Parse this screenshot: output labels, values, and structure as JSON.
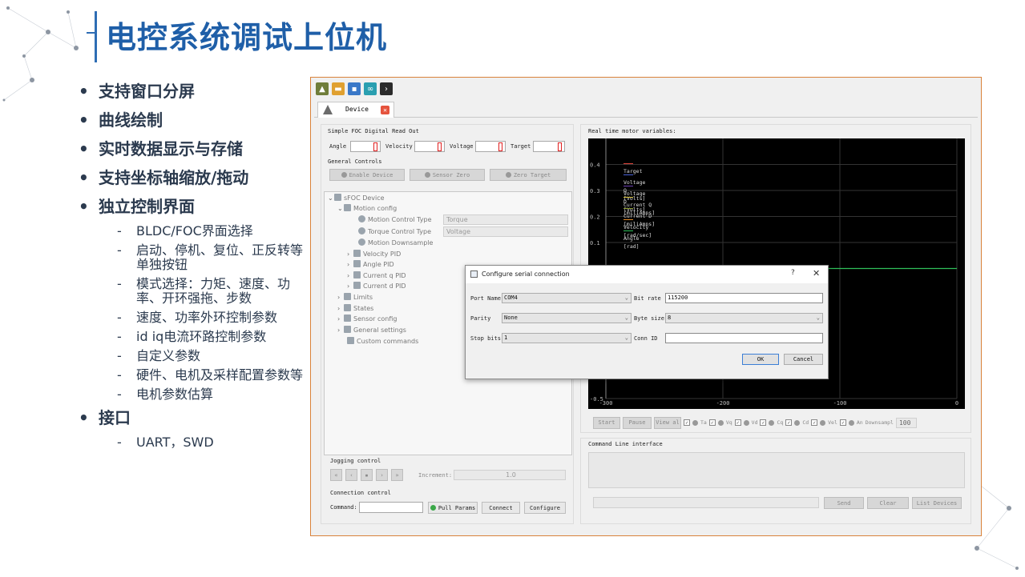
{
  "slide": {
    "title": "电控系统调试上位机",
    "bullets": [
      {
        "text": "支持窗口分屏"
      },
      {
        "text": "曲线绘制"
      },
      {
        "text": "实时数据显示与存储"
      },
      {
        "text": "支持坐标轴缩放/拖动"
      },
      {
        "text": "独立控制界面"
      }
    ],
    "sub_bullets": [
      "BLDC/FOC界面选择",
      "启动、停机、复位、正反转等单独按钮",
      "模式选择：力矩、速度、功率、开环强拖、步数",
      "速度、功率外环控制参数",
      "id iq电流环路控制参数",
      "自定义参数",
      "硬件、电机及采样配置参数等",
      "电机参数估算"
    ],
    "bullet_interface": "接口",
    "sub_interface": "UART，SWD",
    "accent_color": "#1f5fa8"
  },
  "app": {
    "tab_label": "Device",
    "readout": {
      "group_title": "Simple FOC Digital Read Out",
      "labels": [
        "Angle",
        "Velocity",
        "Voltage",
        "Target"
      ]
    },
    "general": {
      "group_title": "General Controls",
      "enable": "Enable Device",
      "sensor_zero": "Sensor Zero",
      "zero_target": "Zero Target"
    },
    "tree": {
      "root": "sFOC Device",
      "motion_config": "Motion config",
      "motion_control_type": "Motion Control Type",
      "motion_control_value": "Torque",
      "torque_control_type": "Torque Control Type",
      "torque_control_value": "Voltage",
      "motion_downsample": "Motion Downsample",
      "velocity_pid": "Velocity PID",
      "angle_pid": "Angle PID",
      "current_q_pid": "Current q PID",
      "current_d_pid": "Current d PID",
      "limits": "Limits",
      "states": "States",
      "sensor_config": "Sensor config",
      "general_settings": "General settings",
      "custom_commands": "Custom commands"
    },
    "jogging": {
      "group_title": "Jogging control",
      "increment_label": "Increment:",
      "increment_value": "1.0"
    },
    "connection": {
      "group_title": "Connection control",
      "command_label": "Command:",
      "pull_params": "Pull Params",
      "connect": "Connect",
      "configure": "Configure"
    },
    "plot": {
      "group_title": "Real time motor variables:",
      "controls": {
        "start": "Start",
        "pause": "Pause",
        "view_all": "View al",
        "checks": [
          "Ta",
          "Vq",
          "Vd",
          "Cq",
          "Cd",
          "Vel",
          "An"
        ],
        "downsample_label": "Downsampl",
        "downsample_value": "100"
      }
    },
    "cli": {
      "group_title": "Command Line interface",
      "send": "Send",
      "clear": "Clear",
      "list_devices": "List Devices"
    }
  },
  "chart_data": {
    "type": "line",
    "xlim": [
      -300,
      0
    ],
    "ylim": [
      -0.5,
      0.5
    ],
    "x_ticks": [
      "-300",
      "-200",
      "-100",
      "0"
    ],
    "y_ticks": [
      "0.4",
      "0.3",
      "0.2",
      "0.1",
      "-0.5"
    ],
    "grid": true,
    "legend_placement": "top-left",
    "series": [
      {
        "name": "Target",
        "color": "#e0443a"
      },
      {
        "name": "Voltage Q [Volts]",
        "color": "#4a62d8"
      },
      {
        "name": "Voltage D [Volts]",
        "color": "#6b3fb0"
      },
      {
        "name": "Current Q [miliAmps]",
        "color": "#d8c23a"
      },
      {
        "name": "Current D [miliAmps]",
        "color": "#8a9a2e"
      },
      {
        "name": "Velocity [rad/sec]",
        "color": "#e08a2a"
      },
      {
        "name": "Angle [rad]",
        "color": "#2fbf5a",
        "x": [
          -300,
          0
        ],
        "y": [
          0,
          0
        ]
      }
    ]
  },
  "dialog": {
    "title": "Configure serial connection",
    "help": "?",
    "close": "✕",
    "port_label": "Port Name",
    "port_value": "COM4",
    "bitrate_label": "Bit rate",
    "bitrate_value": "115200",
    "parity_label": "Parity",
    "parity_value": "None",
    "bytesize_label": "Byte size",
    "bytesize_value": "8",
    "stopbits_label": "Stop bits",
    "stopbits_value": "1",
    "connid_label": "Conn ID",
    "connid_value": "",
    "ok": "OK",
    "cancel": "Cancel"
  }
}
